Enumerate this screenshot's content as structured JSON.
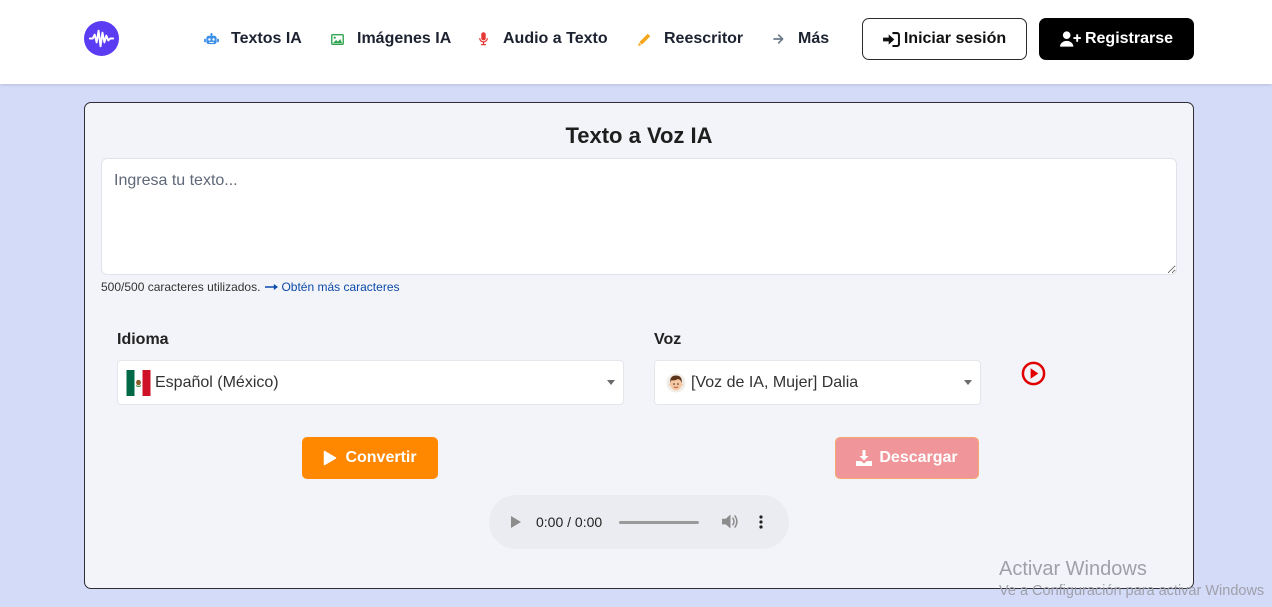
{
  "header": {
    "logo_icon": "waveform-logo-icon",
    "nav": [
      {
        "icon": "robot-icon",
        "icon_color": "#3b8fe8",
        "label": "Textos IA"
      },
      {
        "icon": "image-icon",
        "icon_color": "#2ea44f",
        "label": "Imágenes IA"
      },
      {
        "icon": "microphone-icon",
        "icon_color": "#e53935",
        "label": "Audio a Texto"
      },
      {
        "icon": "pencil-icon",
        "icon_color": "#f6a51a",
        "label": "Reescritor"
      },
      {
        "icon": "arrow-right-icon",
        "icon_color": "#6b7a8a",
        "label": "Más"
      }
    ],
    "login": {
      "icon": "sign-in-icon",
      "label": "Iniciar sesión"
    },
    "register": {
      "icon": "user-plus-icon",
      "label": "Registrarse"
    }
  },
  "tts": {
    "title": "Texto a Voz IA",
    "text_input": {
      "placeholder": "Ingresa tu texto...",
      "value": ""
    },
    "char_counter": "500/500 caracteres utilizados.",
    "more_chars_link": {
      "icon": "long-arrow-right-icon",
      "label": "Obtén más caracteres"
    },
    "language": {
      "label": "Idioma",
      "selected": "Español (México)",
      "flag_icon": "mexico-flag-icon"
    },
    "voice": {
      "label": "Voz",
      "selected": "[Voz de IA, Mujer] Dalia",
      "avatar_icon": "voice-avatar-icon",
      "preview_icon": "play-circle-icon"
    },
    "convert_button": {
      "icon": "play-icon",
      "label": "Convertir"
    },
    "download_button": {
      "icon": "download-icon",
      "label": "Descargar"
    },
    "audio_player": {
      "time": "0:00 / 0:00",
      "progress": 0
    }
  },
  "os_watermark": {
    "title": "Activar Windows",
    "subtitle": "Ve a Configuración para activar Windows"
  },
  "colors": {
    "page_background": "#d3dbf9",
    "card_background": "#f3f4f9",
    "logo": "#5b3cf2",
    "convert_button": "#ff8800",
    "download_button": "#f0969a",
    "register_button": "#000000",
    "link": "#0b4aa8",
    "preview_play": "#e00000"
  }
}
